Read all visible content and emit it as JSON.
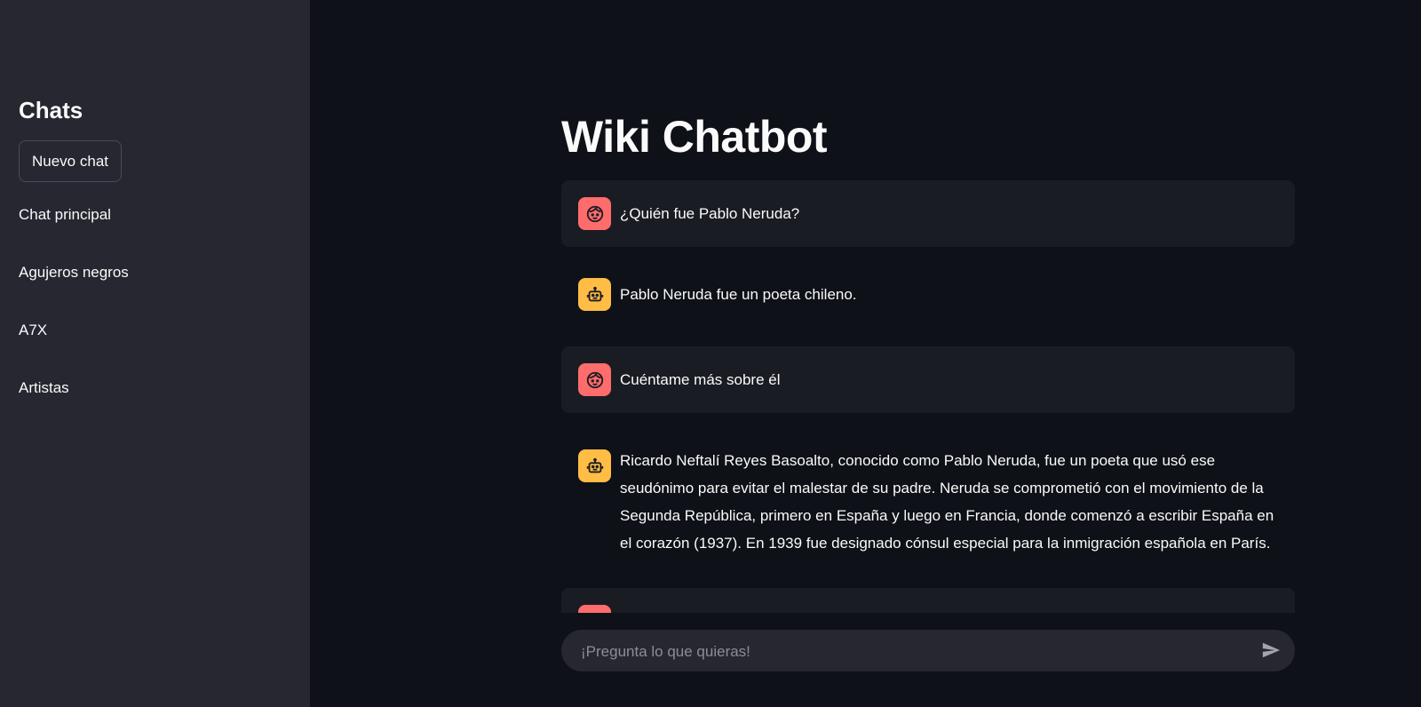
{
  "sidebar": {
    "title": "Chats",
    "new_chat_label": "Nuevo chat",
    "items": [
      {
        "label": "Chat principal"
      },
      {
        "label": "Agujeros negros"
      },
      {
        "label": "A7X"
      },
      {
        "label": "Artistas"
      }
    ]
  },
  "main": {
    "title": "Wiki Chatbot",
    "messages": [
      {
        "role": "user",
        "avatar_icon": "user-face-icon",
        "text": "¿Quién fue Pablo Neruda?"
      },
      {
        "role": "assistant",
        "avatar_icon": "robot-icon",
        "text": "Pablo Neruda fue un poeta chileno."
      },
      {
        "role": "user",
        "avatar_icon": "user-face-icon",
        "text": "Cuéntame más sobre él"
      },
      {
        "role": "assistant",
        "avatar_icon": "robot-icon",
        "text": "Ricardo Neftalí Reyes Basoalto, conocido como Pablo Neruda, fue un poeta que usó ese seudónimo para evitar el malestar de su padre. Neruda se comprometió con el movimiento de la Segunda República, primero en España y luego en Francia, donde comenzó a escribir España en el corazón (1937). En 1939 fue designado cónsul especial para la inmigración española en París."
      },
      {
        "role": "user",
        "avatar_icon": "user-face-icon",
        "text": ""
      }
    ]
  },
  "input": {
    "placeholder": "¡Pregunta lo que quieras!",
    "value": "",
    "send_icon": "send-icon"
  },
  "colors": {
    "background": "#0e1117",
    "sidebar": "#262730",
    "user_message_bg": "#1a1c24",
    "user_avatar": "#ff6c6c",
    "assistant_avatar": "#ffbd45",
    "text": "#fafafa"
  }
}
